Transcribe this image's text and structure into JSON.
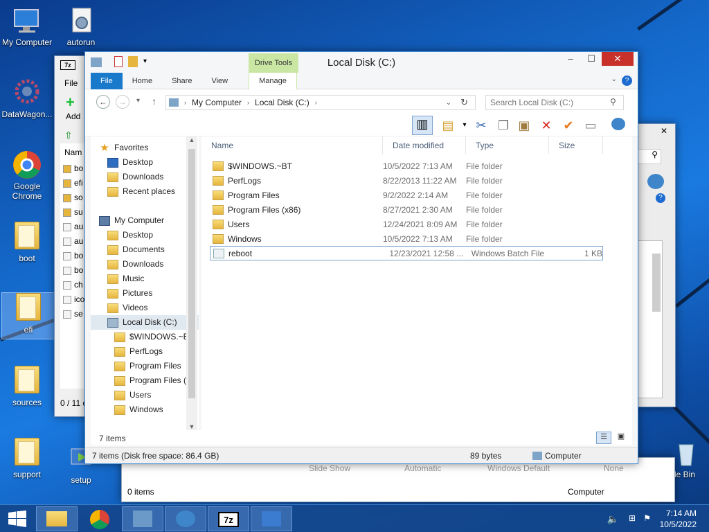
{
  "desktop": {
    "icons": [
      {
        "label": "My Computer"
      },
      {
        "label": "autorun"
      },
      {
        "label": "DataWagon..."
      },
      {
        "label": "Google Chrome"
      },
      {
        "label": "boot"
      },
      {
        "label": "efi"
      },
      {
        "label": "sources"
      },
      {
        "label": "support"
      },
      {
        "label": "setup"
      },
      {
        "label": "le Bin"
      }
    ]
  },
  "bg_7z": {
    "logo": "7z",
    "file_tab": "File",
    "add_label": "Add",
    "name_col": "Nam",
    "files": [
      "bo",
      "efi",
      "so",
      "su",
      "au",
      "au",
      "bo",
      "bo",
      "ch",
      "ico",
      "se"
    ],
    "status": "0 / 11 o"
  },
  "bg_bottom": {
    "labels": [
      "Slide Show",
      "Automatic",
      "Windows Default",
      "None"
    ],
    "status": "0 items",
    "computer": "Computer"
  },
  "window": {
    "title": "Local Disk (C:)",
    "context_tab": "Drive Tools",
    "tabs": [
      "File",
      "Home",
      "Share",
      "View",
      "Manage"
    ],
    "address": [
      "My Computer",
      "Local Disk (C:)"
    ],
    "search_placeholder": "Search Local Disk (C:)",
    "columns": [
      "Name",
      "Date modified",
      "Type",
      "Size"
    ],
    "files": [
      {
        "name": "$WINDOWS.~BT",
        "date": "10/5/2022 7:13 AM",
        "type": "File folder",
        "size": ""
      },
      {
        "name": "PerfLogs",
        "date": "8/22/2013 11:22 AM",
        "type": "File folder",
        "size": ""
      },
      {
        "name": "Program Files",
        "date": "9/2/2022 2:14 AM",
        "type": "File folder",
        "size": ""
      },
      {
        "name": "Program Files (x86)",
        "date": "8/27/2021 2:30 AM",
        "type": "File folder",
        "size": ""
      },
      {
        "name": "Users",
        "date": "12/24/2021 8:09 AM",
        "type": "File folder",
        "size": ""
      },
      {
        "name": "Windows",
        "date": "10/5/2022 7:13 AM",
        "type": "File folder",
        "size": ""
      },
      {
        "name": "reboot",
        "date": "12/23/2021 12:58 ...",
        "type": "Windows Batch File",
        "size": "1 KB"
      }
    ],
    "nav": {
      "favorites": "Favorites",
      "fav_items": [
        "Desktop",
        "Downloads",
        "Recent places"
      ],
      "computer": "My Computer",
      "pc_items": [
        "Desktop",
        "Documents",
        "Downloads",
        "Music",
        "Pictures",
        "Videos"
      ],
      "disk": "Local Disk (C:)",
      "disk_items": [
        "$WINDOWS.~B",
        "PerfLogs",
        "Program Files",
        "Program Files (",
        "Users",
        "Windows"
      ]
    },
    "item_count": "7 items",
    "status": {
      "left": "7 items (Disk free space: 86.4 GB)",
      "size": "89 bytes",
      "computer": "Computer"
    }
  },
  "taskbar": {
    "time": "7:14 AM",
    "date": "10/5/2022"
  }
}
